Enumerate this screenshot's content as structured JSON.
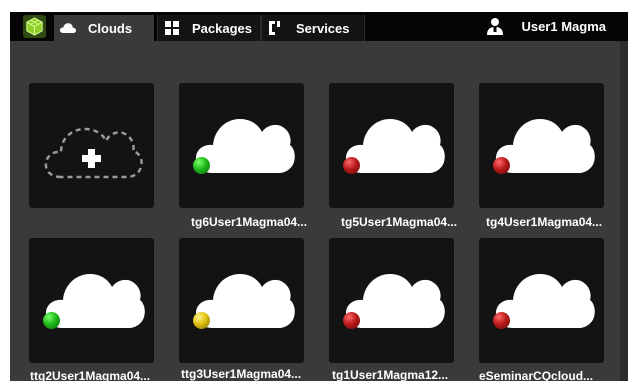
{
  "nav": {
    "tabs": [
      {
        "label": "Clouds",
        "icon": "cloud-icon",
        "active": true
      },
      {
        "label": "Packages",
        "icon": "packages-icon",
        "active": false
      },
      {
        "label": "Services",
        "icon": "services-icon",
        "active": false
      }
    ],
    "user": {
      "name": "User1 Magma",
      "icon": "user-icon"
    }
  },
  "clouds": [
    {
      "label": "tg6User1Magma04...",
      "status": "green"
    },
    {
      "label": "tg5User1Magma04...",
      "status": "red"
    },
    {
      "label": "tg4User1Magma04...",
      "status": "red"
    },
    {
      "label": "ttg2User1Magma04...",
      "status": "green"
    },
    {
      "label": "ttg3User1Magma04...",
      "status": "yellow"
    },
    {
      "label": "tg1User1Magma12...",
      "status": "red"
    },
    {
      "label": "eSeminarCQcloud...",
      "status": "red"
    }
  ],
  "colors": {
    "topbar": "#050505",
    "background": "#3a3a3a",
    "tile": "#131313",
    "status_green": "#1fb81a",
    "status_red": "#b81a1a",
    "status_yellow": "#e0c010"
  }
}
